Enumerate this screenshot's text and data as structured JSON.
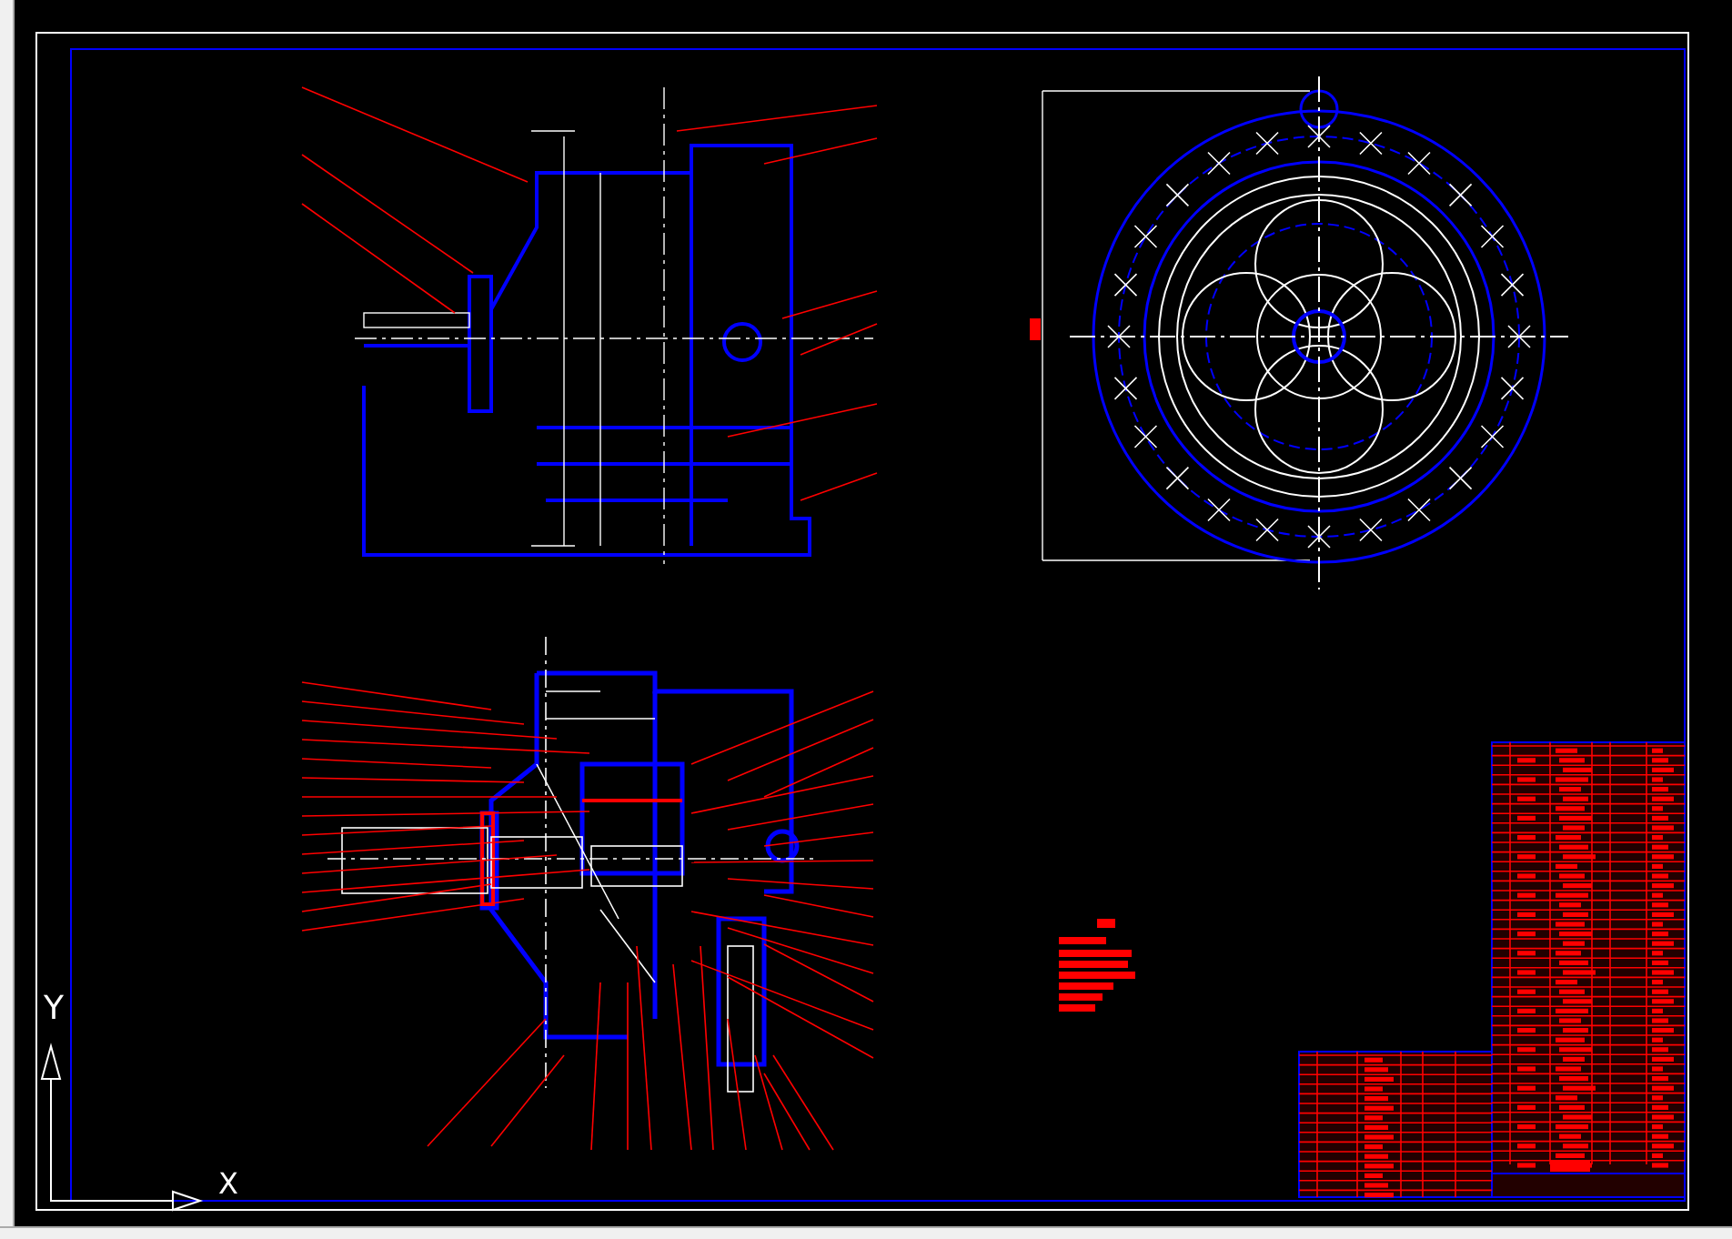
{
  "viewport": {
    "ucs_icon": {
      "y_label": "Y",
      "x_label": "X"
    }
  }
}
